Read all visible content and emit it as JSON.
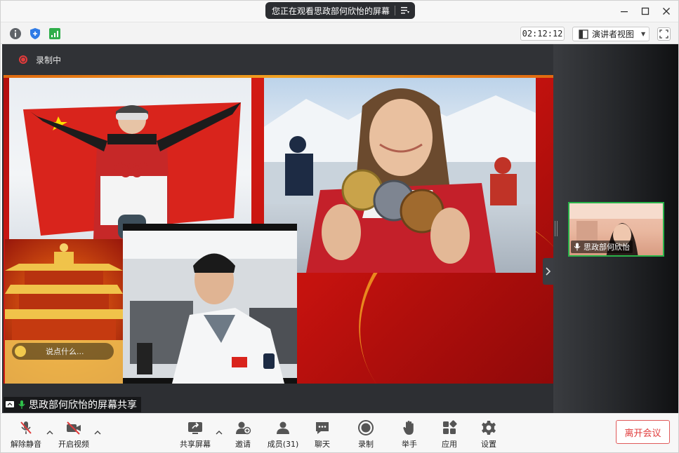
{
  "window": {
    "title": "您正在观看思政部何欣怡的屏幕"
  },
  "infobar": {
    "timer": "02:12:12",
    "view_mode": "演讲者视图"
  },
  "recording": {
    "label": "录制中"
  },
  "slide": {
    "chat_placeholder": "说点什么..."
  },
  "share": {
    "label": "思政部何欣怡的屏幕共享"
  },
  "participant": {
    "name": "思政部何欣怡"
  },
  "toolbar": {
    "unmute": "解除静音",
    "start_video": "开启视频",
    "share_screen": "共享屏幕",
    "invite": "邀请",
    "members": "成员(31)",
    "chat": "聊天",
    "record": "录制",
    "raise_hand": "举手",
    "apps": "应用",
    "settings": "设置",
    "leave": "离开会议"
  },
  "colors": {
    "accent_red": "#e03c3c",
    "active_speaker": "#29b34a",
    "slide_red": "#c5120e"
  }
}
